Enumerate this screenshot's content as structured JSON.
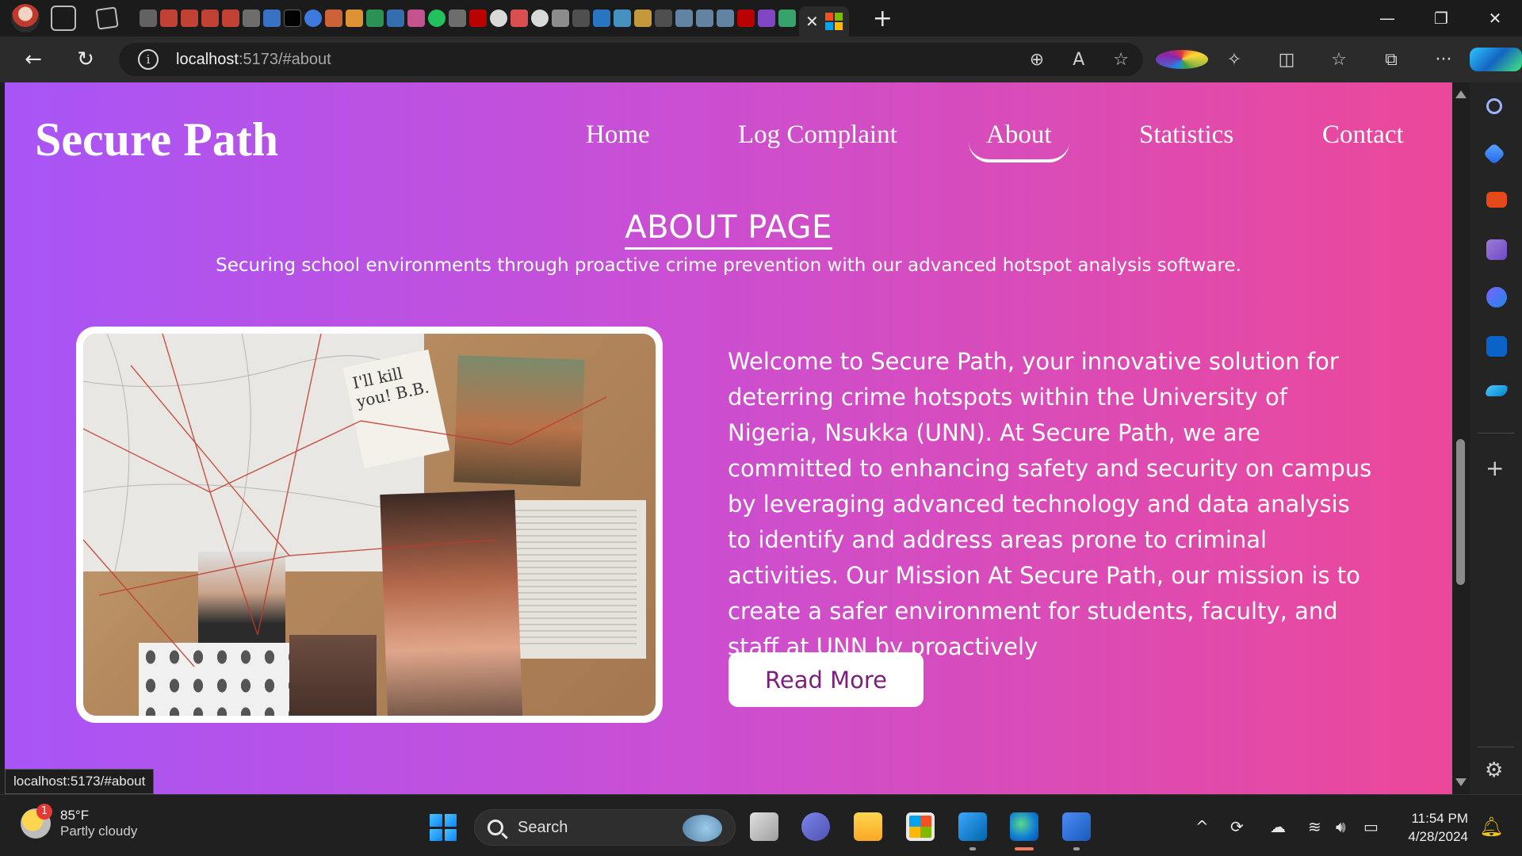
{
  "browser": {
    "url_host": "localhost",
    "url_rest": ":5173/#about",
    "status_url": "localhost:5173/#about"
  },
  "site": {
    "brand": "Secure Path",
    "nav": [
      {
        "label": "Home"
      },
      {
        "label": "Log Complaint"
      },
      {
        "label": "About",
        "active": true
      },
      {
        "label": "Statistics"
      },
      {
        "label": "Contact"
      }
    ],
    "about": {
      "title": "ABOUT PAGE",
      "subtitle": "Securing school environments through proactive crime prevention with our advanced hotspot analysis software.",
      "body": "Welcome to Secure Path, your innovative solution for deterring crime hotspots within the University of Nigeria, Nsukka (UNN). At Secure Path, we are committed to enhancing safety and security on campus by leveraging advanced technology and data analysis to identify and address areas prone to criminal activities. Our Mission At Secure Path, our mission is to create a safer environment for students, faculty, and staff at UNN by proactively",
      "read_more": "Read More",
      "image_note": "I'll kill you! B.B."
    }
  },
  "taskbar": {
    "weather_temp": "85°F",
    "weather_cond": "Partly cloudy",
    "weather_badge": "1",
    "search_label": "Search",
    "time": "11:54 PM",
    "date": "4/28/2024"
  },
  "colors": {
    "gradient_start": "#a855f7",
    "gradient_end": "#ec4899",
    "read_more_text": "#7a1f7a"
  },
  "icons": [
    "back-arrow-icon",
    "refresh-icon",
    "info-icon",
    "zoom-icon",
    "read-aloud-icon",
    "favorite-star-icon",
    "extensions-icon",
    "split-screen-icon",
    "favorites-icon",
    "collections-icon",
    "more-icon",
    "copilot-icon"
  ]
}
